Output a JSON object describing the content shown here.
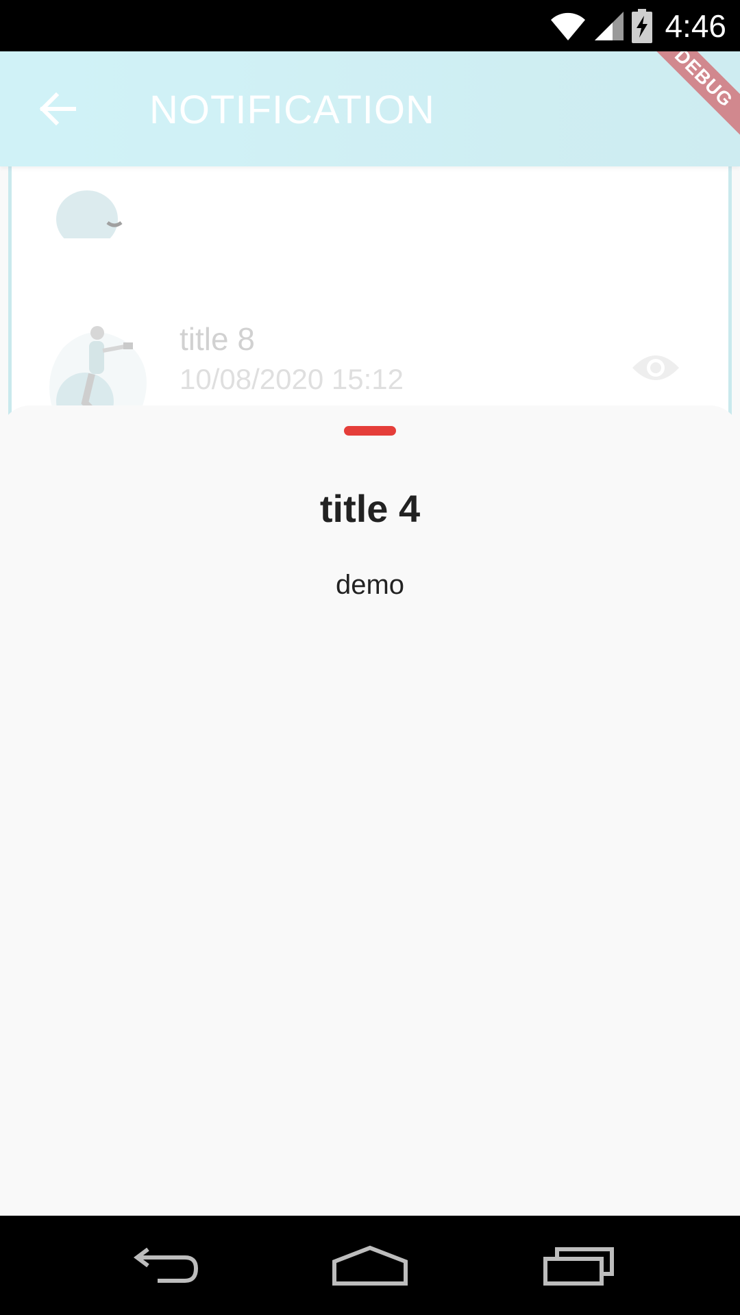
{
  "status_bar": {
    "time": "4:46",
    "icons": [
      "wifi-icon",
      "signal-icon",
      "battery-charging-icon"
    ]
  },
  "app_bar": {
    "title": "NOTIFICATION",
    "back_icon": "arrow-left-icon",
    "debug_banner": "DEBUG",
    "background": "#b4ebf3"
  },
  "notifications": [
    {
      "title": "title 8",
      "date": "10/08/2020 15:12",
      "icon": "eye-icon"
    }
  ],
  "bottom_sheet": {
    "title": "title 4",
    "body": "demo",
    "handle_color": "#e53e3a"
  },
  "nav_bar": {
    "buttons": [
      "back-icon",
      "home-icon",
      "recent-apps-icon"
    ]
  }
}
